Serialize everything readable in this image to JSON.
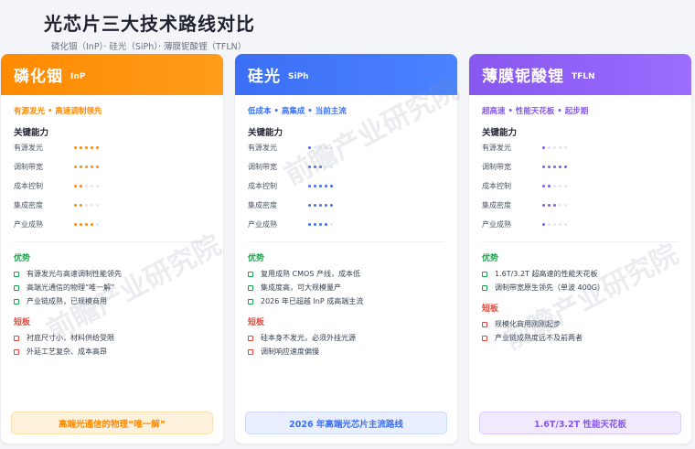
{
  "header": {
    "title": "光芯片三大技术路线对比",
    "subtitle": "磷化铟（InP）· 硅光（SiPh）· 薄膜铌酸锂（TFLN）"
  },
  "capability_title": "关键能力",
  "pros_title": "优势",
  "cons_title": "短板",
  "watermark": "前瞻产业研究院",
  "colors": {
    "inp": "#ff8a00",
    "siph": "#3b6ff5",
    "tfln": "#8757f0",
    "pro": "#1aa34a",
    "con": "#e5483b"
  },
  "cards": [
    {
      "name": "磷化铟",
      "abbr": "InP",
      "tagline": "有源发光 • 高速调制领先",
      "capabilities": [
        {
          "label": "有源发光",
          "score": 5
        },
        {
          "label": "调制带宽",
          "score": 5
        },
        {
          "label": "成本控制",
          "score": 2
        },
        {
          "label": "集成密度",
          "score": 2
        },
        {
          "label": "产业成熟",
          "score": 4
        }
      ],
      "pros": [
        "有源发光与高速调制性能领先",
        "高端光通信的物理“唯一解”",
        "产业链成熟，已规模商用"
      ],
      "cons": [
        "衬底尺寸小，材料供给受限",
        "外延工艺复杂、成本高昂"
      ],
      "footer": "高端光通信的物理“唯一解”"
    },
    {
      "name": "硅光",
      "abbr": "SiPh",
      "tagline": "低成本 • 高集成 • 当前主流",
      "capabilities": [
        {
          "label": "有源发光",
          "score": 1
        },
        {
          "label": "调制带宽",
          "score": 3
        },
        {
          "label": "成本控制",
          "score": 5
        },
        {
          "label": "集成密度",
          "score": 5
        },
        {
          "label": "产业成熟",
          "score": 4
        }
      ],
      "pros": [
        "复用成熟 CMOS 产线，成本低",
        "集成度高，可大规模量产",
        "2026 年已超越 InP 成高端主流"
      ],
      "cons": [
        "硅本身不发光，必须外挂光源",
        "调制响应速度偏慢"
      ],
      "footer": "2026 年高端光芯片主流路线"
    },
    {
      "name": "薄膜铌酸锂",
      "abbr": "TFLN",
      "tagline": "超高速 • 性能天花板 • 起步期",
      "capabilities": [
        {
          "label": "有源发光",
          "score": 1
        },
        {
          "label": "调制带宽",
          "score": 5
        },
        {
          "label": "成本控制",
          "score": 2
        },
        {
          "label": "集成密度",
          "score": 3
        },
        {
          "label": "产业成熟",
          "score": 1
        }
      ],
      "pros": [
        "1.6T/3.2T 超高速的性能天花板",
        "调制带宽原生领先（单波 400G）"
      ],
      "cons": [
        "规模化商用刚刚起步",
        "产业链成熟度远不及前两者"
      ],
      "footer": "1.6T/3.2T 性能天花板"
    }
  ]
}
